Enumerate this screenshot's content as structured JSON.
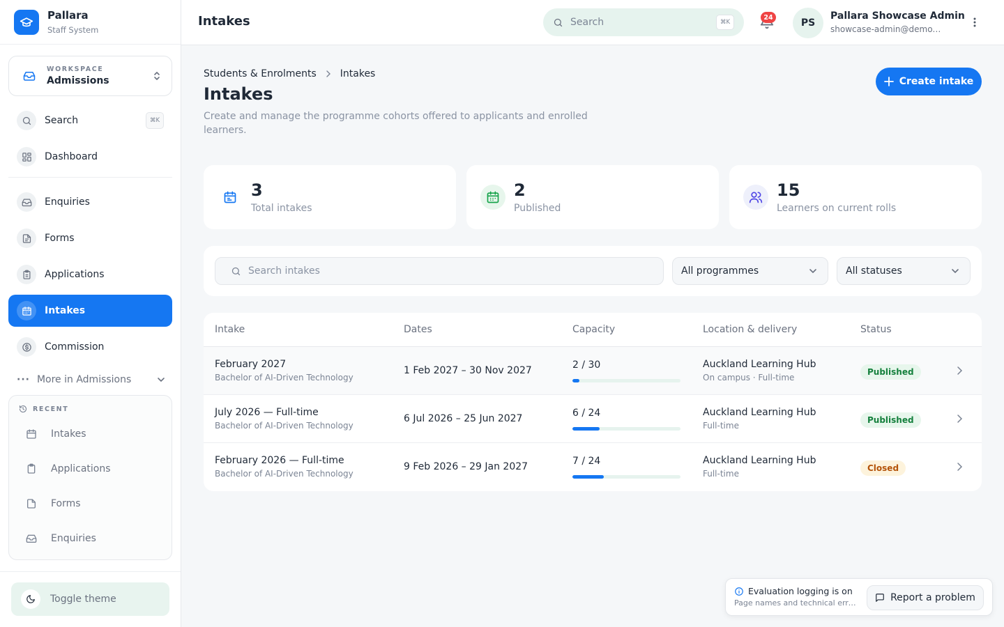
{
  "brand": {
    "name": "Pallara",
    "subtitle": "Staff System"
  },
  "workspace": {
    "label": "WORKSPACE",
    "name": "Admissions"
  },
  "sidebar": {
    "search": {
      "label": "Search",
      "shortcut": "⌘K"
    },
    "items": [
      {
        "label": "Dashboard",
        "icon": "dashboard-icon"
      },
      {
        "label": "Enquiries",
        "icon": "inbox-icon"
      },
      {
        "label": "Forms",
        "icon": "document-icon"
      },
      {
        "label": "Applications",
        "icon": "clipboard-icon"
      },
      {
        "label": "Intakes",
        "icon": "calendar-icon",
        "active": true
      },
      {
        "label": "Commission",
        "icon": "dollar-icon"
      }
    ],
    "more_label": "More in Admissions",
    "recent": {
      "label": "RECENT",
      "items": [
        {
          "label": "Intakes",
          "icon": "calendar-icon"
        },
        {
          "label": "Applications",
          "icon": "clipboard-icon"
        },
        {
          "label": "Forms",
          "icon": "document-icon"
        },
        {
          "label": "Enquiries",
          "icon": "inbox-icon"
        }
      ]
    },
    "toggle_theme": "Toggle theme"
  },
  "header": {
    "title": "Intakes",
    "search_placeholder": "Search",
    "search_shortcut": "⌘K",
    "notification_count": "24",
    "user": {
      "initials": "PS",
      "name": "Pallara Showcase Admin",
      "email": "showcase-admin@demo.pallara.app"
    }
  },
  "page": {
    "breadcrumb": [
      "Students & Enrolments",
      "Intakes"
    ],
    "title": "Intakes",
    "description": "Create and manage the programme cohorts offered to applicants and enrolled learners.",
    "create_button": "Create intake"
  },
  "stats": [
    {
      "value": "3",
      "label": "Total intakes",
      "icon": "calendar-icon",
      "color": "#1577f2"
    },
    {
      "value": "2",
      "label": "Published",
      "icon": "calendar-check-icon",
      "color": "#16a34a"
    },
    {
      "value": "15",
      "label": "Learners on current rolls",
      "icon": "users-icon",
      "color": "#4f46e5"
    }
  ],
  "filters": {
    "search_placeholder": "Search intakes",
    "programme": "All programmes",
    "status": "All statuses"
  },
  "table": {
    "columns": [
      "Intake",
      "Dates",
      "Capacity",
      "Location & delivery",
      "Status"
    ],
    "rows": [
      {
        "name": "February 2027",
        "programme": "Bachelor of AI-Driven Technology",
        "dates": "1 Feb 2027 – 30 Nov 2027",
        "capacity": "2 / 30",
        "fill": 0.067,
        "location": "Auckland Learning Hub",
        "delivery": "On campus · Full-time",
        "status": "Published"
      },
      {
        "name": "July 2026 — Full-time",
        "programme": "Bachelor of AI-Driven Technology",
        "dates": "6 Jul 2026 – 25 Jun 2027",
        "capacity": "6 / 24",
        "fill": 0.25,
        "location": "Auckland Learning Hub",
        "delivery": "Full-time",
        "status": "Published"
      },
      {
        "name": "February 2026 — Full-time",
        "programme": "Bachelor of AI-Driven Technology",
        "dates": "9 Feb 2026 – 29 Jan 2027",
        "capacity": "7 / 24",
        "fill": 0.292,
        "location": "Auckland Learning Hub",
        "delivery": "Full-time",
        "status": "Closed"
      }
    ]
  },
  "toast": {
    "title": "Evaluation logging is on",
    "subtitle": "Page names and technical errors are recorded for evaluation.",
    "button": "Report a problem"
  },
  "colors": {
    "accent": "#1577f2",
    "published": "#15803d",
    "closed": "#b45309"
  }
}
